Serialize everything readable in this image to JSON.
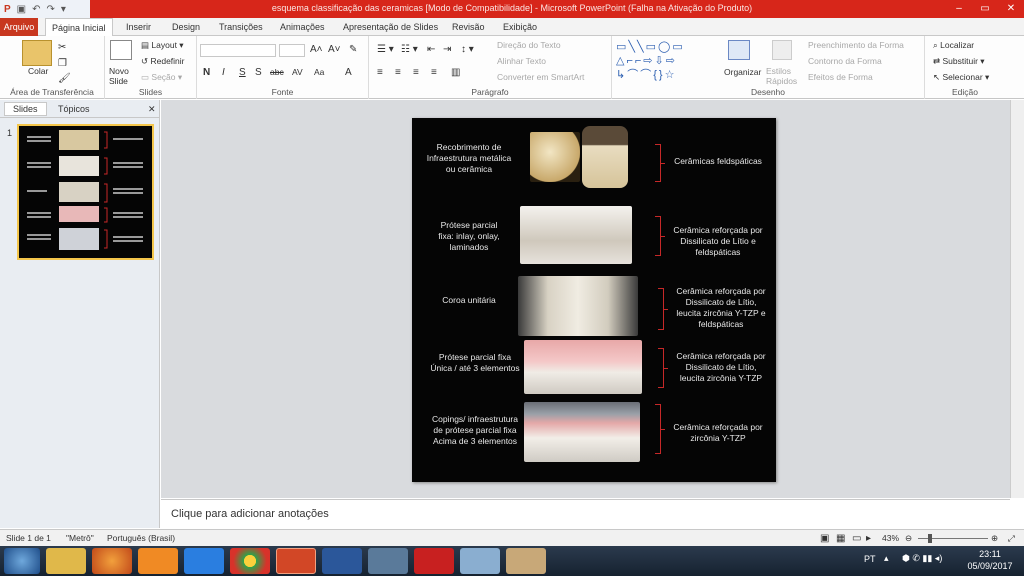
{
  "window": {
    "title": "esquema classificação das ceramicas [Modo de Compatibilidade] - Microsoft PowerPoint (Falha na Ativação do Produto)",
    "accent": "#d7261a"
  },
  "tabs": [
    "Arquivo",
    "Página Inicial",
    "Inserir",
    "Design",
    "Transições",
    "Animações",
    "Apresentação de Slides",
    "Revisão",
    "Exibição"
  ],
  "ribbon": {
    "clipboard": {
      "label": "Área de Transferência",
      "paste": "Colar"
    },
    "slides": {
      "label": "Slides",
      "new_slide_1": "Novo",
      "new_slide_2": "Slide",
      "layout": "Layout",
      "reset": "Redefinir",
      "section": "Seção"
    },
    "font": {
      "label": "Fonte",
      "bold": "N",
      "italic": "I",
      "underline": "S",
      "shadow": "S",
      "strike": "abc",
      "spacing": "AV",
      "case": "Aa",
      "color": "A"
    },
    "paragraph": {
      "label": "Parágrafo",
      "text_direction": "Direção do Texto",
      "align_text": "Alinhar Texto",
      "smartart": "Converter em SmartArt"
    },
    "drawing": {
      "label": "Desenho",
      "arrange": "Organizar",
      "quick_styles_1": "Estilos",
      "quick_styles_2": "Rápidos",
      "fill": "Preenchimento da Forma",
      "outline": "Contorno da Forma",
      "effects": "Efeitos de Forma"
    },
    "editing": {
      "label": "Edição",
      "find": "Localizar",
      "replace": "Substituir",
      "select": "Selecionar"
    }
  },
  "pane": {
    "tab_slides": "Slides",
    "tab_outline": "Tópicos",
    "slide_number": "1"
  },
  "slide": {
    "rows": [
      {
        "left": "Recobrimento de\nInfraestrutura metálica\nou cerâmica",
        "right": "Cerâmicas feldspáticas"
      },
      {
        "left": "Prótese parcial\nfixa: inlay, onlay,\nlaminados",
        "right": "Cerâmica reforçada por\nDissilicato de Lítio e\nfeldspáticas"
      },
      {
        "left": "Coroa unitária",
        "right": "Cerâmica reforçada por\nDissilicato de Lítio,\nleucita zircônia Y-TZP e\nfeldspáticas"
      },
      {
        "left": "Prótese parcial fixa\nÚnica / até 3 elementos",
        "right": "Cerâmica reforçada por\nDissilicato de Lítio,\nleucita zircônia Y-TZP"
      },
      {
        "left": "Copings/ infraestrutura\nde prótese parcial fixa\nAcima de 3 elementos",
        "right": "Cerâmica reforçada por\nzircônia Y-TZP"
      }
    ]
  },
  "notes": {
    "placeholder": "Clique para adicionar anotações"
  },
  "status": {
    "slide": "Slide 1 de 1",
    "theme": "\"Metrô\"",
    "language": "Português (Brasil)",
    "zoom": "43%"
  },
  "taskbar": {
    "lang": "PT",
    "time": "23:11",
    "date": "05/09/2017"
  }
}
